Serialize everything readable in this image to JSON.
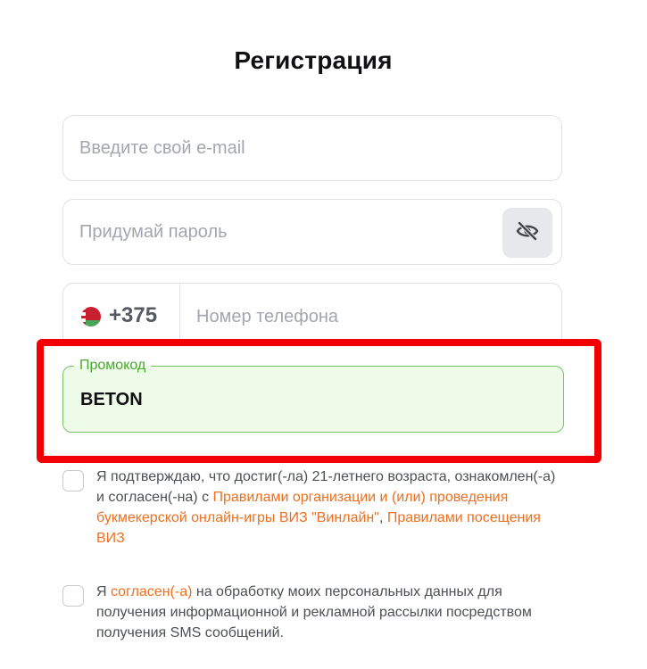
{
  "header": {
    "title": "Регистрация"
  },
  "email": {
    "placeholder": "Введите свой e-mail",
    "value": ""
  },
  "password": {
    "placeholder": "Придумай пароль",
    "value": "",
    "toggle_icon": "eye-off-icon"
  },
  "phone": {
    "country_flag": "belarus-flag-icon",
    "code": "+375",
    "placeholder": "Номер телефона",
    "value": ""
  },
  "promo": {
    "label": "Промокод",
    "value": "BETON"
  },
  "terms": {
    "checked": false,
    "text_1": "Я подтверждаю, что достиг(-ла) 21-летнего возраста, ознакомлен(-а) и согласен(-на) с ",
    "link_1": "Правилами организации и (или) проведения букмекерской онлайн-игры ВИЗ \"Винлайн\"",
    "text_2": ", ",
    "link_2": "Правилами посещения ВИЗ"
  },
  "consent": {
    "checked": false,
    "text_1": "Я ",
    "link_1": "согласен(-а)",
    "text_2": " на обработку моих персональных данных для получения информационной и рекламной рассылки посредством получения SMS сообщений."
  },
  "colors": {
    "accent_link": "#ee6f1f",
    "promo_green": "#48a82e",
    "promo_bg": "#effbe9",
    "highlight_red": "#f20000"
  }
}
